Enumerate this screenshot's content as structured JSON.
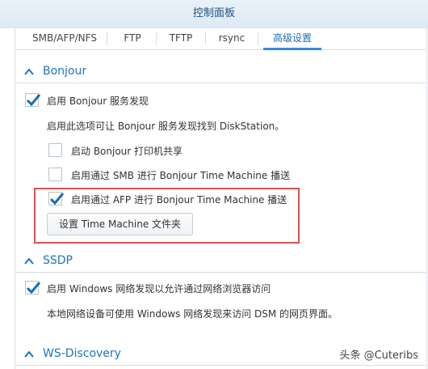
{
  "window": {
    "title": "控制面板"
  },
  "tabs": [
    {
      "label": "SMB/AFP/NFS",
      "active": false
    },
    {
      "label": "FTP",
      "active": false
    },
    {
      "label": "TFTP",
      "active": false
    },
    {
      "label": "rsync",
      "active": false
    },
    {
      "label": "高级设置",
      "active": true
    }
  ],
  "bonjour": {
    "title": "Bonjour",
    "enable": {
      "label": "启用 Bonjour 服务发现",
      "checked": true
    },
    "description": "启用此选项可让 Bonjour 服务发现找到 DiskStation。",
    "printer_share": {
      "label": "启动 Bonjour 打印机共享",
      "checked": false
    },
    "smb_time_machine": {
      "label": "启用通过 SMB 进行 Bonjour Time Machine 播送",
      "checked": false
    },
    "afp_time_machine": {
      "label": "启用通过 AFP 进行 Bonjour Time Machine 播送",
      "checked": true
    },
    "set_folder_button": "设置 Time Machine 文件夹"
  },
  "ssdp": {
    "title": "SSDP",
    "enable": {
      "label": "启用 Windows 网络发现以允许通过网络浏览器访问",
      "checked": true
    },
    "description": "本地网络设备可使用 Windows 网络发现来访问 DSM 的网页界面。"
  },
  "ws_discovery": {
    "title": "WS-Discovery"
  },
  "watermark": "头条 @Cuteribs",
  "colors": {
    "accent": "#1f73be",
    "highlight": "#d9534f",
    "check": "#1a6fb5"
  }
}
